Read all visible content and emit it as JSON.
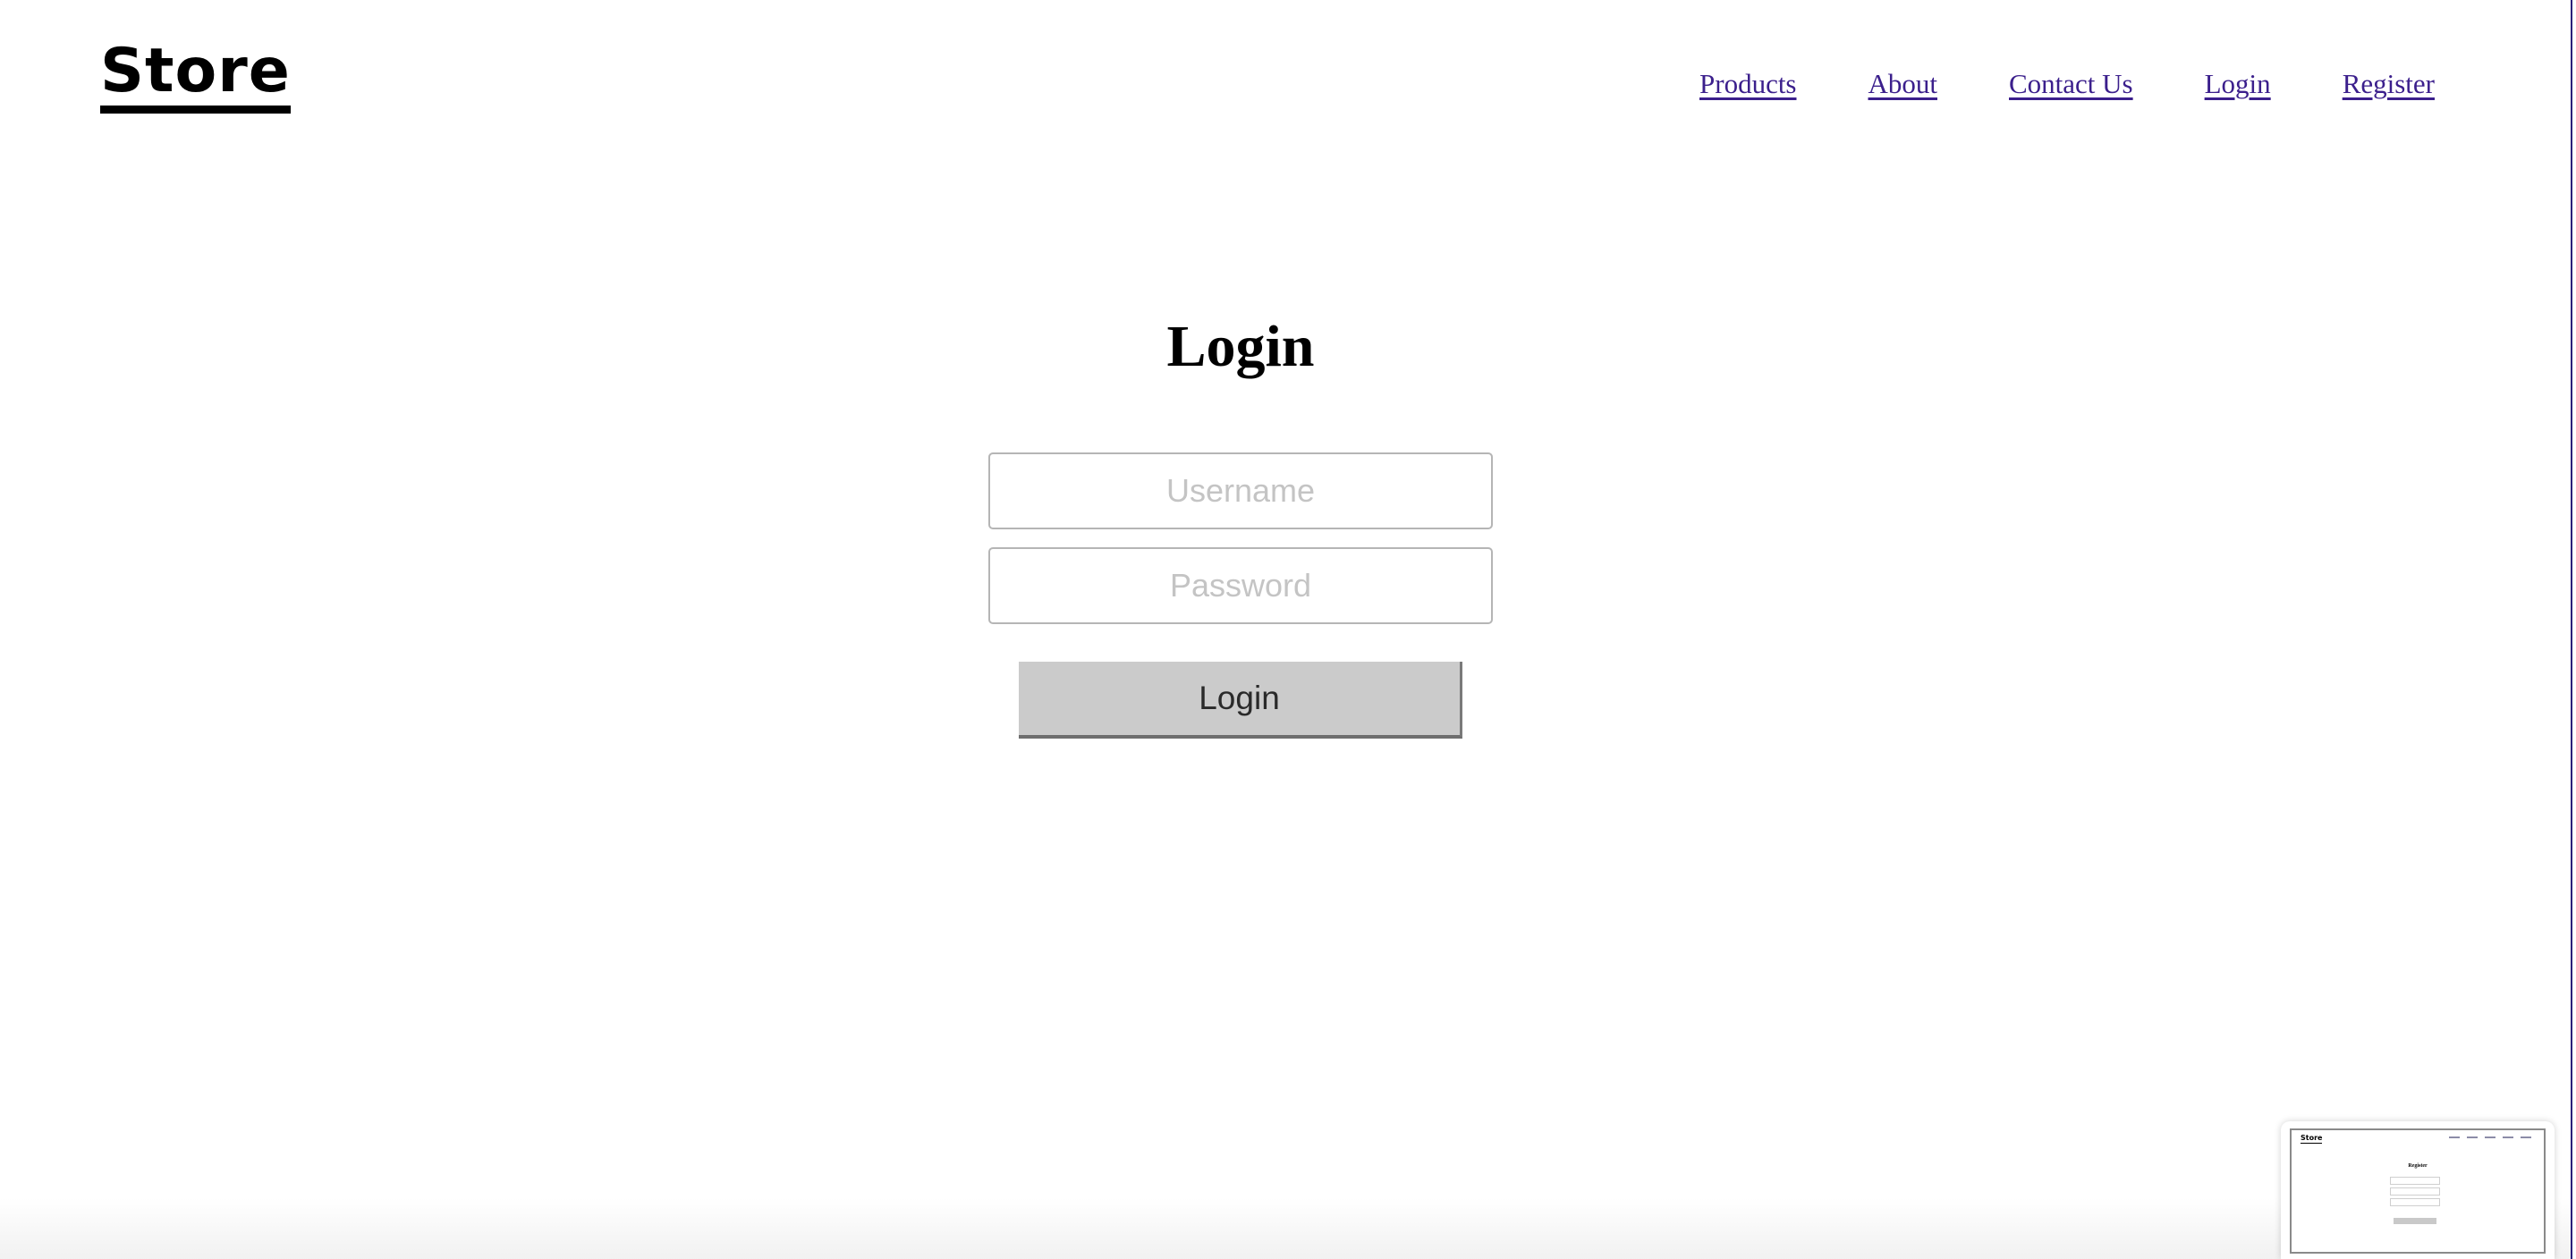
{
  "header": {
    "logo": "Store",
    "nav": [
      {
        "label": "Products"
      },
      {
        "label": "About"
      },
      {
        "label": "Contact Us"
      },
      {
        "label": "Login"
      },
      {
        "label": "Register"
      }
    ]
  },
  "login_form": {
    "title": "Login",
    "username": {
      "placeholder": "Username",
      "value": ""
    },
    "password": {
      "placeholder": "Password",
      "value": ""
    },
    "submit_label": "Login"
  },
  "preview": {
    "logo": "Store",
    "title": "Register"
  },
  "colors": {
    "link": "#3b1f8c",
    "button_bg": "#cbcbcb",
    "input_border": "#b5b5b5"
  }
}
